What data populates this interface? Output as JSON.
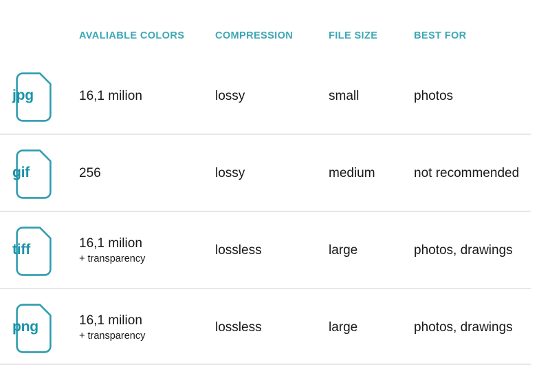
{
  "table": {
    "columns": [
      {
        "key": "icon",
        "label": ""
      },
      {
        "key": "colors",
        "label": "AVALIABLE COLORS"
      },
      {
        "key": "compression",
        "label": "COMPRESSION"
      },
      {
        "key": "filesize",
        "label": "FILE SIZE"
      },
      {
        "key": "bestfor",
        "label": "BEST FOR"
      }
    ],
    "rows": [
      {
        "format": "jpg",
        "icon_name": "file-icon-jpg",
        "colors": "16,1 milion",
        "colors_note": "",
        "compression": "lossy",
        "filesize": "small",
        "bestfor": "photos"
      },
      {
        "format": "gif",
        "icon_name": "file-icon-gif",
        "colors": "256",
        "colors_note": "",
        "compression": "lossy",
        "filesize": "medium",
        "bestfor": "not recommended"
      },
      {
        "format": "tiff",
        "icon_name": "file-icon-tiff",
        "colors": "16,1 milion",
        "colors_note": "+ transparency",
        "compression": "lossless",
        "filesize": "large",
        "bestfor": "photos, drawings"
      },
      {
        "format": "png",
        "icon_name": "file-icon-png",
        "colors": "16,1 milion",
        "colors_note": "+ transparency",
        "compression": "lossless",
        "filesize": "large",
        "bestfor": "photos, drawings"
      }
    ]
  },
  "colors": {
    "header_teal": "#3ba7b4",
    "icon_teal": "#1a94a8",
    "icon_stroke": "#2f9cb0",
    "text_dark": "#17181a",
    "divider": "#e6e7e9",
    "background": "#ffffff"
  }
}
